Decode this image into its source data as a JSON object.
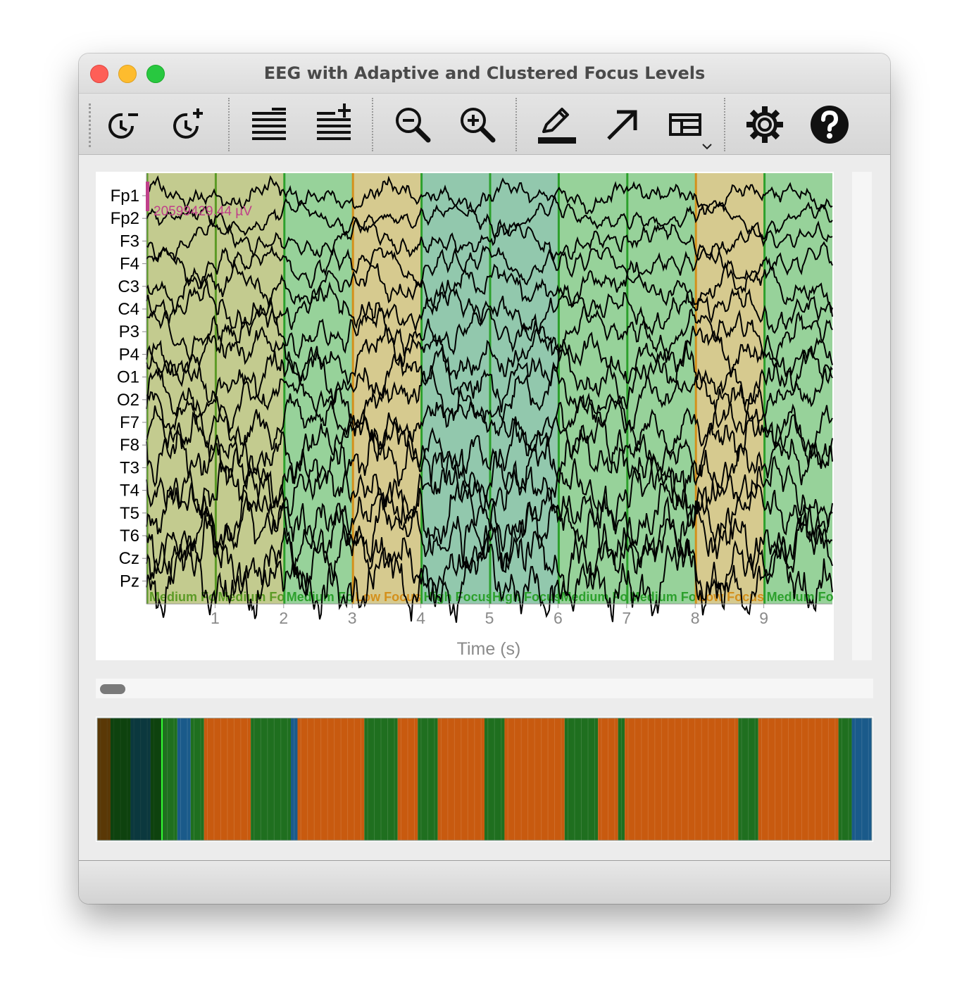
{
  "window": {
    "title": "EEG with Adaptive and Clustered Focus Levels"
  },
  "toolbar": {
    "buttons": [
      {
        "name": "decrease-time-scale-button",
        "icon": "clock-minus-icon"
      },
      {
        "name": "increase-time-scale-button",
        "icon": "clock-plus-icon"
      },
      {
        "name": "decrease-channels-button",
        "icon": "lines-minus-icon"
      },
      {
        "name": "increase-channels-button",
        "icon": "lines-plus-icon"
      },
      {
        "name": "zoom-out-button",
        "icon": "zoom-out-icon"
      },
      {
        "name": "zoom-in-button",
        "icon": "zoom-in-icon"
      },
      {
        "name": "annotate-button",
        "icon": "pen-icon"
      },
      {
        "name": "arrow-button",
        "icon": "arrow-icon"
      },
      {
        "name": "layout-button",
        "icon": "layout-icon"
      },
      {
        "name": "settings-button",
        "icon": "gear-icon"
      },
      {
        "name": "help-button",
        "icon": "help-icon"
      }
    ]
  },
  "chart_data": {
    "type": "line",
    "xlabel": "Time (s)",
    "xlim": [
      0,
      10
    ],
    "x_ticks": [
      1,
      2,
      3,
      4,
      5,
      6,
      7,
      8,
      9
    ],
    "channels": [
      "Fp1",
      "Fp2",
      "F3",
      "F4",
      "C3",
      "C4",
      "P3",
      "P4",
      "O1",
      "O2",
      "F7",
      "F8",
      "T3",
      "T4",
      "T5",
      "T6",
      "Cz",
      "Pz"
    ],
    "scale_label": "20599429.44 µV",
    "segments": [
      {
        "start": 0,
        "end": 1,
        "label": "Medium Focus",
        "color": "#c3cb8f",
        "border": "#5b9a25"
      },
      {
        "start": 1,
        "end": 2,
        "label": "Medium Focus",
        "color": "#c3cb8f",
        "border": "#5b9a25"
      },
      {
        "start": 2,
        "end": 3,
        "label": "Medium Focus",
        "color": "#97d29a",
        "border": "#2ca02c"
      },
      {
        "start": 3,
        "end": 4,
        "label": "Low Focus",
        "color": "#d6ca8f",
        "border": "#d4901b"
      },
      {
        "start": 4,
        "end": 5,
        "label": "High Focus",
        "color": "#92c8ad",
        "border": "#2ca02c"
      },
      {
        "start": 5,
        "end": 6,
        "label": "High Focus",
        "color": "#92c8ad",
        "border": "#2ca02c"
      },
      {
        "start": 6,
        "end": 7,
        "label": "Medium Focus",
        "color": "#97d29a",
        "border": "#2ca02c"
      },
      {
        "start": 7,
        "end": 8,
        "label": "Medium Focus",
        "color": "#97d29a",
        "border": "#2ca02c"
      },
      {
        "start": 8,
        "end": 9,
        "label": "Low Focus",
        "color": "#d6ca8f",
        "border": "#d4901b"
      },
      {
        "start": 9,
        "end": 10,
        "label": "Medium Focus",
        "color": "#97d29a",
        "border": "#2ca02c"
      }
    ],
    "overview_colors": {
      "low": "#c85a0f",
      "medium": "#1f6f1f",
      "high": "#1a5a8a",
      "window": "#103c10"
    }
  }
}
